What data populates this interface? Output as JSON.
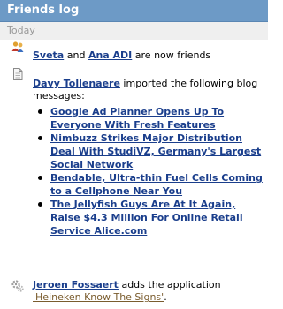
{
  "header": {
    "title": "Friends log"
  },
  "section": {
    "label": "Today"
  },
  "friend_entry": {
    "user1": "Sveta",
    "and": " and ",
    "user2": "Ana ADI",
    "suffix": " are now friends"
  },
  "blog_entry": {
    "user": "Davy Tollenaere",
    "text": " imported the following blog messages:",
    "items": [
      "Google Ad Planner Opens Up To Everyone With Fresh Features",
      "Nimbuzz Strikes Major Distribution Deal With StudiVZ, Germany's Largest Social Network",
      "Bendable, Ultra-thin Fuel Cells Coming to a Cellphone Near You",
      "The Jellyfish Guys Are At It Again, Raise $4.3 Million For Online Retail Service Alice.com"
    ]
  },
  "app_entry": {
    "user": "Jeroen Fossaert",
    "text": " adds the application ",
    "app": "'Heineken Know The Signs'",
    "end": "."
  },
  "icons": {
    "friends": "friends-icon",
    "document": "document-icon",
    "application": "gears-icon"
  }
}
